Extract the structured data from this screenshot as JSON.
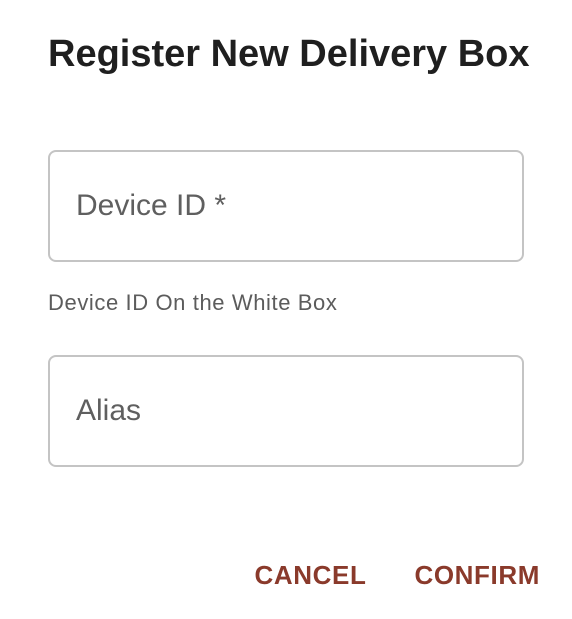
{
  "dialog": {
    "title": "Register New Delivery Box",
    "fields": {
      "device_id": {
        "placeholder": "Device ID *",
        "value": "",
        "helper_text": "Device ID On the White Box"
      },
      "alias": {
        "placeholder": "Alias",
        "value": ""
      }
    },
    "actions": {
      "cancel_label": "CANCEL",
      "confirm_label": "CONFIRM"
    }
  },
  "colors": {
    "accent": "#8a3a2b",
    "title_text": "#1f1f1f",
    "field_border": "#c4c4c4",
    "helper_text": "#5c5c5c"
  }
}
